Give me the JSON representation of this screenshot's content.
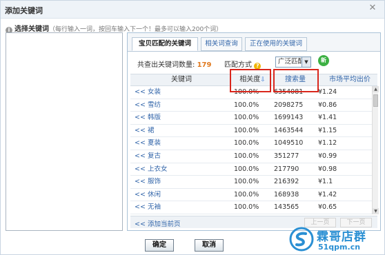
{
  "dialog": {
    "title": "添加关键词",
    "close_glyph": "✕"
  },
  "instruction": {
    "label": "选择关键词",
    "hint": "（每行输入一词，按回车输入下一个！最多可以输入200个词）"
  },
  "tabs": [
    {
      "label": "宝贝匹配的关键词",
      "active": true
    },
    {
      "label": "相关词查询",
      "active": false
    },
    {
      "label": "正在使用的关键词",
      "active": false
    }
  ],
  "summary": {
    "label": "共查出关键词数量:",
    "count": "179"
  },
  "match": {
    "label": "匹配方式",
    "help_glyph": "?",
    "selected": "广泛匹配",
    "new_badge": "新"
  },
  "table": {
    "headers": {
      "keyword": "关键词",
      "relevance": "相关度",
      "sort_glyph": "⇩",
      "volume": "搜索量",
      "price": "市场平均出价"
    },
    "rows": [
      {
        "prefix": "<<",
        "keyword": "女装",
        "relevance": "100.0%",
        "volume": "6354081",
        "price": "¥1.24"
      },
      {
        "prefix": "<<",
        "keyword": "雪纺",
        "relevance": "100.0%",
        "volume": "2098275",
        "price": "¥0.86"
      },
      {
        "prefix": "<<",
        "keyword": "韩版",
        "relevance": "100.0%",
        "volume": "1699143",
        "price": "¥1.41"
      },
      {
        "prefix": "<<",
        "keyword": "裙",
        "relevance": "100.0%",
        "volume": "1463544",
        "price": "¥1.15"
      },
      {
        "prefix": "<<",
        "keyword": "夏装",
        "relevance": "100.0%",
        "volume": "1049510",
        "price": "¥1.12"
      },
      {
        "prefix": "<<",
        "keyword": "复古",
        "relevance": "100.0%",
        "volume": "351277",
        "price": "¥0.99"
      },
      {
        "prefix": "<<",
        "keyword": "上衣女",
        "relevance": "100.0%",
        "volume": "217790",
        "price": "¥0.98"
      },
      {
        "prefix": "<<",
        "keyword": "服饰",
        "relevance": "100.0%",
        "volume": "216392",
        "price": "¥1.1"
      },
      {
        "prefix": "<<",
        "keyword": "休闲",
        "relevance": "100.0%",
        "volume": "168938",
        "price": "¥1.42"
      },
      {
        "prefix": "<<",
        "keyword": "无袖",
        "relevance": "100.0%",
        "volume": "143565",
        "price": "¥0.65"
      }
    ],
    "footer": {
      "add_page": "<< 添加当前页",
      "prev": "上一页",
      "next": "下一页"
    }
  },
  "buttons": {
    "confirm": "确定",
    "cancel": "取消"
  },
  "watermark": {
    "name": "霖哥店群",
    "url": "51qpm.cn"
  },
  "colors": {
    "highlight_box": "#d9261c",
    "link_blue": "#3366aa",
    "count_orange": "#e0781c",
    "new_badge_green": "#3cb043",
    "watermark_blue": "#2a8fd3"
  }
}
